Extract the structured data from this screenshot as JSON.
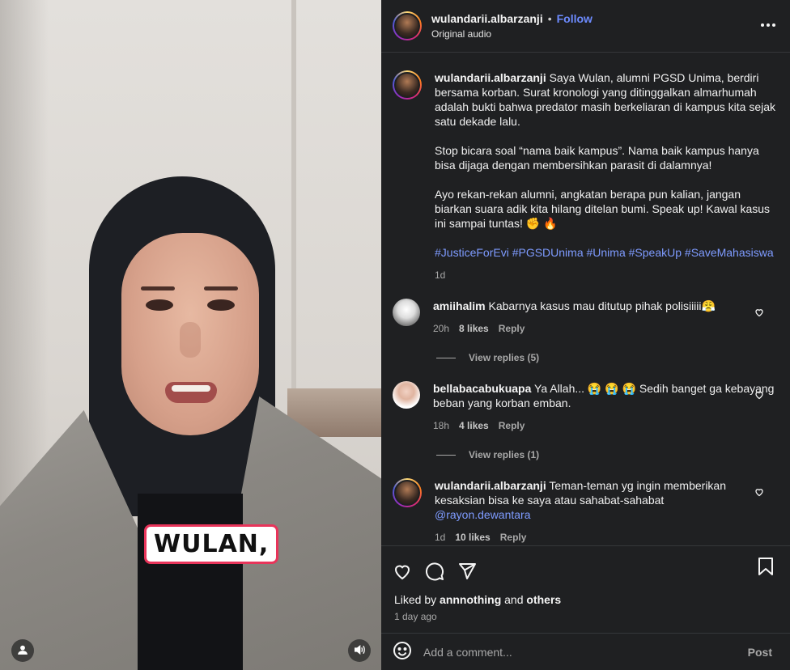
{
  "post": {
    "username": "wulandarii.albarzanji",
    "separator": "•",
    "follow_label": "Follow",
    "audio": "Original audio",
    "caption_intro": "Saya Wulan, alumni PGSD Unima, berdiri bersama korban. Surat kronologi yang ditinggalkan almarhumah adalah bukti bahwa predator masih berkeliaran di kampus kita sejak satu dekade lalu.",
    "caption_p2": "Stop bicara soal “nama baik kampus”. Nama baik kampus hanya bisa dijaga dengan membersihkan parasit di dalamnya!",
    "caption_p3": "Ayo rekan-rekan alumni, angkatan berapa pun kalian, jangan biarkan suara adik kita hilang ditelan bumi. Speak up! Kawal kasus ini sampai tuntas! ✊ 🔥",
    "hashtags": "#JusticeForEvi #PGSDUnima #Unima #SpeakUp #SaveMahasiswa",
    "time": "1d"
  },
  "video": {
    "caption_overlay": "WULAN,"
  },
  "comments": [
    {
      "username": "amiihalim",
      "text": "Kabarnya kasus mau ditutup pihak polisiiiii😤",
      "time": "20h",
      "likes": "8 likes",
      "reply": "Reply",
      "view_replies": "View replies (5)"
    },
    {
      "username": "bellabacabukuapa",
      "text": "Ya Allah... 😭 😭 😭 Sedih banget ga kebayang beban yang korban emban.",
      "time": "18h",
      "likes": "4 likes",
      "reply": "Reply",
      "view_replies": "View replies (1)"
    },
    {
      "username": "wulandarii.albarzanji",
      "text": "Teman-teman yg ingin memberikan kesaksian bisa ke saya atau sahabat-sahabat",
      "mention": "@rayon.dewantara",
      "time": "1d",
      "likes": "10 likes",
      "reply": "Reply"
    }
  ],
  "footer": {
    "liked_prefix": "Liked by",
    "liked_user": "annnothing",
    "liked_and": "and",
    "liked_others": "others",
    "ago": "1 day ago",
    "comment_placeholder": "Add a comment...",
    "post_label": "Post"
  },
  "icons": {
    "like": "heart-icon",
    "comment": "comment-icon",
    "share": "send-icon",
    "save": "bookmark-icon",
    "more": "more-icon",
    "emoji": "emoji-icon",
    "user": "user-icon",
    "audio": "speaker-icon"
  },
  "colors": {
    "accent": "#6d8bff",
    "panel_bg": "#1f2022",
    "caption_border": "#e8345a"
  }
}
